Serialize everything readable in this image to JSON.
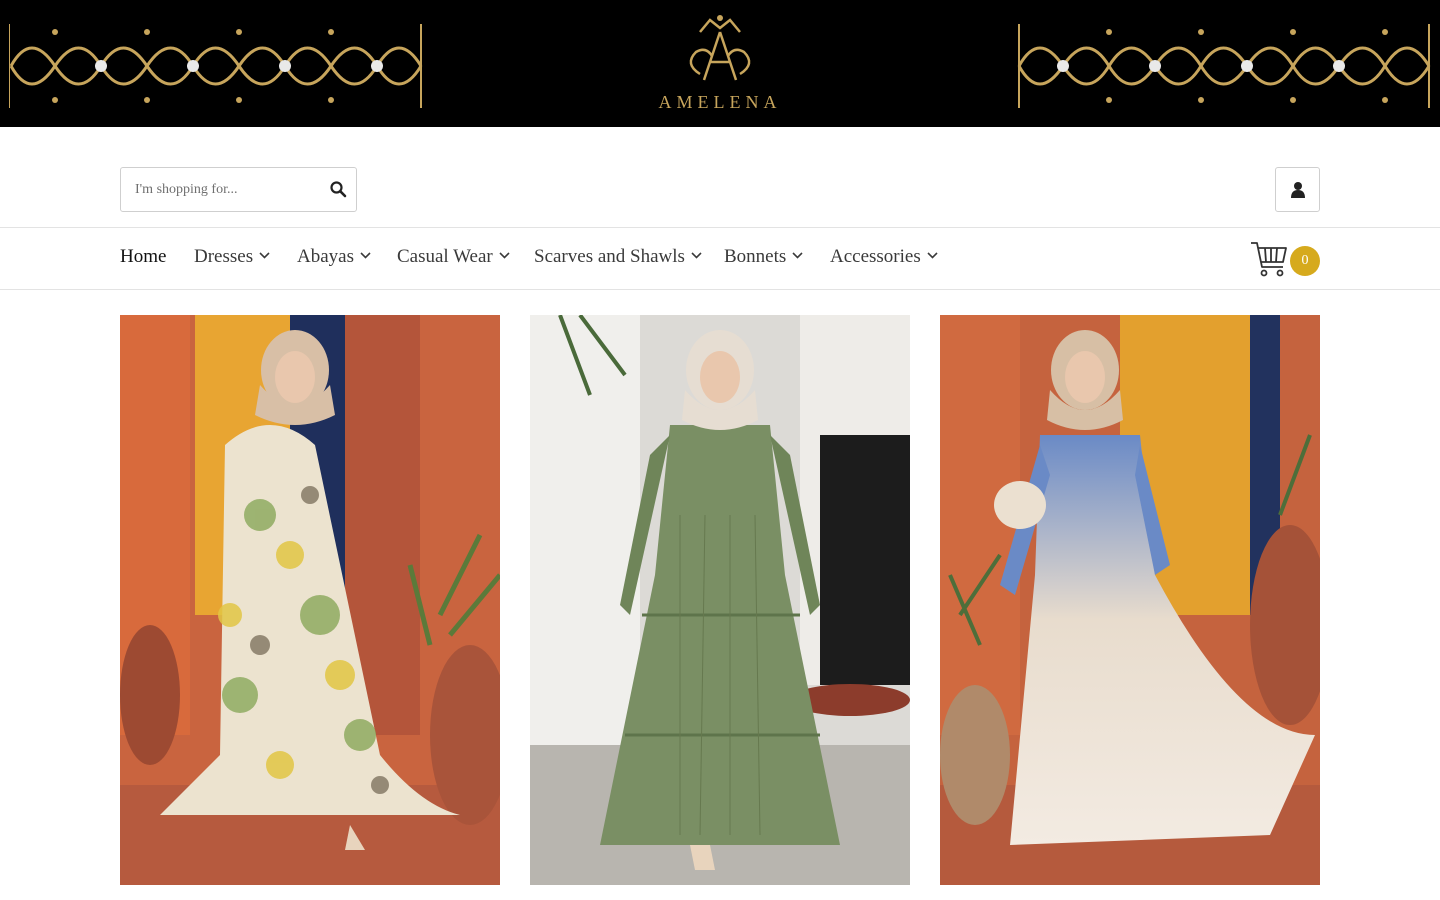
{
  "brand": {
    "name": "AMELENA"
  },
  "search": {
    "placeholder": "I'm shopping for..."
  },
  "nav": {
    "items": [
      {
        "label": "Home",
        "has_dropdown": false
      },
      {
        "label": "Dresses",
        "has_dropdown": true
      },
      {
        "label": "Abayas",
        "has_dropdown": true
      },
      {
        "label": "Casual Wear",
        "has_dropdown": true
      },
      {
        "label": "Scarves and Shawls",
        "has_dropdown": true
      },
      {
        "label": "Bonnets",
        "has_dropdown": true
      },
      {
        "label": "Accessories",
        "has_dropdown": true
      }
    ]
  },
  "cart": {
    "count": "0"
  },
  "icons": {
    "search": "search-icon",
    "account": "user-icon",
    "cart": "cart-icon",
    "dropdown": "chevron-down-icon"
  },
  "colors": {
    "banner_bg": "#000000",
    "gold": "#c7a55c",
    "cart_badge": "#d6aa1d",
    "text": "#3a3a3a"
  }
}
